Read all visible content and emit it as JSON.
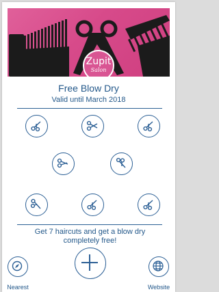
{
  "brand": {
    "logo_line1": "Zupit",
    "logo_line2": "Salon"
  },
  "offer": {
    "title": "Free Blow Dry",
    "valid": "Valid until March 2018",
    "description": "Get 7 haircuts and get a blow dry completely free!"
  },
  "stamps": {
    "total": 7,
    "icon": "scissors-icon"
  },
  "nav": {
    "nearest_label": "Nearest",
    "website_label": "Website"
  },
  "colors": {
    "accent": "#2b5f95",
    "hero": "#d74a8a",
    "text": "#23588a"
  }
}
